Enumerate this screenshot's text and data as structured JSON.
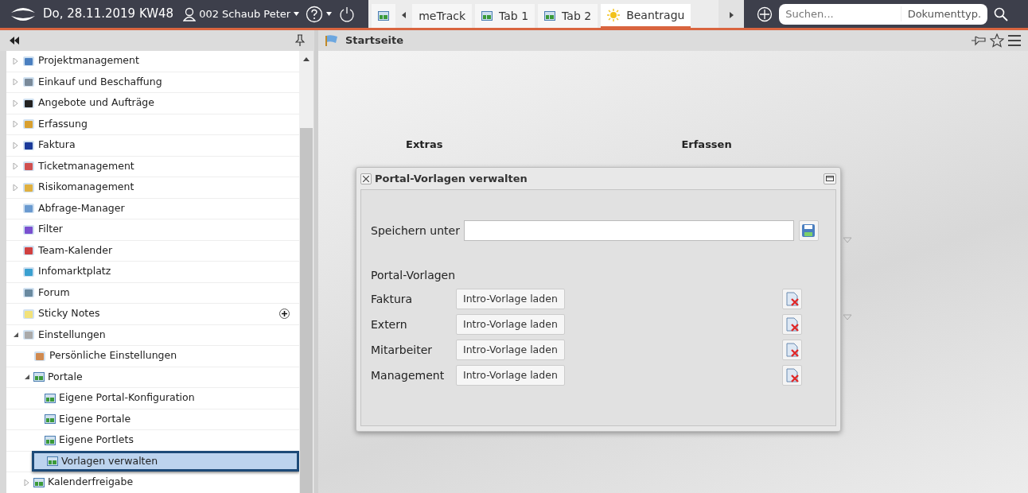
{
  "top_bar": {
    "date": "Do, 28.11.2019 KW48",
    "user": "002 Schaub Peter"
  },
  "tabs": [
    {
      "label": "meTrack",
      "selected": false
    },
    {
      "label": "Tab 1",
      "selected": false
    },
    {
      "label": "Tab 2",
      "selected": false
    },
    {
      "label": "Beantragu",
      "selected": true
    }
  ],
  "search": {
    "placeholder": "Suchen...",
    "type_label": "Dokumenttyp."
  },
  "sidebar": {
    "items": [
      {
        "label": "Projektmanagement",
        "selected": false,
        "expanded": false
      },
      {
        "label": "Einkauf und Beschaffung",
        "selected": false,
        "expanded": false
      },
      {
        "label": "Angebote und Aufträge",
        "selected": false,
        "expanded": false
      },
      {
        "label": "Erfassung",
        "selected": false,
        "expanded": false
      },
      {
        "label": "Faktura",
        "selected": false,
        "expanded": false
      },
      {
        "label": "Ticketmanagement",
        "selected": false,
        "expanded": false
      },
      {
        "label": "Risikomanagement",
        "selected": false,
        "expanded": false
      },
      {
        "label": "Abfrage-Manager",
        "selected": false
      },
      {
        "label": "Filter",
        "selected": false
      },
      {
        "label": "Team-Kalender",
        "selected": false
      },
      {
        "label": "Infomarktplatz",
        "selected": false
      },
      {
        "label": "Forum",
        "selected": false
      },
      {
        "label": "Sticky Notes",
        "selected": false,
        "add_button": true
      },
      {
        "label": "Einstellungen",
        "selected": false,
        "expanded": true,
        "children": [
          {
            "label": "Persönliche Einstellungen",
            "selected": false
          },
          {
            "label": "Portale",
            "selected": false,
            "expanded": true,
            "children": [
              {
                "label": "Eigene Portal-Konfiguration",
                "selected": false
              },
              {
                "label": "Eigene Portale",
                "selected": false
              },
              {
                "label": "Eigene Portlets",
                "selected": false
              },
              {
                "label": "Vorlagen verwalten",
                "selected": true
              }
            ]
          },
          {
            "label": "Kalenderfreigabe",
            "selected": false,
            "expanded": false
          }
        ]
      }
    ]
  },
  "main": {
    "title": "Startseite",
    "map_labels": [
      "Extras",
      "Erfassen"
    ]
  },
  "dialog": {
    "title": "Portal-Vorlagen verwalten",
    "save_label": "Speichern unter",
    "section": "Portal-Vorlagen",
    "templates": [
      {
        "name": "Faktura",
        "button": "Intro-Vorlage laden"
      },
      {
        "name": "Extern",
        "button": "Intro-Vorlage laden"
      },
      {
        "name": "Mitarbeiter",
        "button": "Intro-Vorlage laden"
      },
      {
        "name": "Management",
        "button": "Intro-Vorlage laden"
      }
    ]
  }
}
